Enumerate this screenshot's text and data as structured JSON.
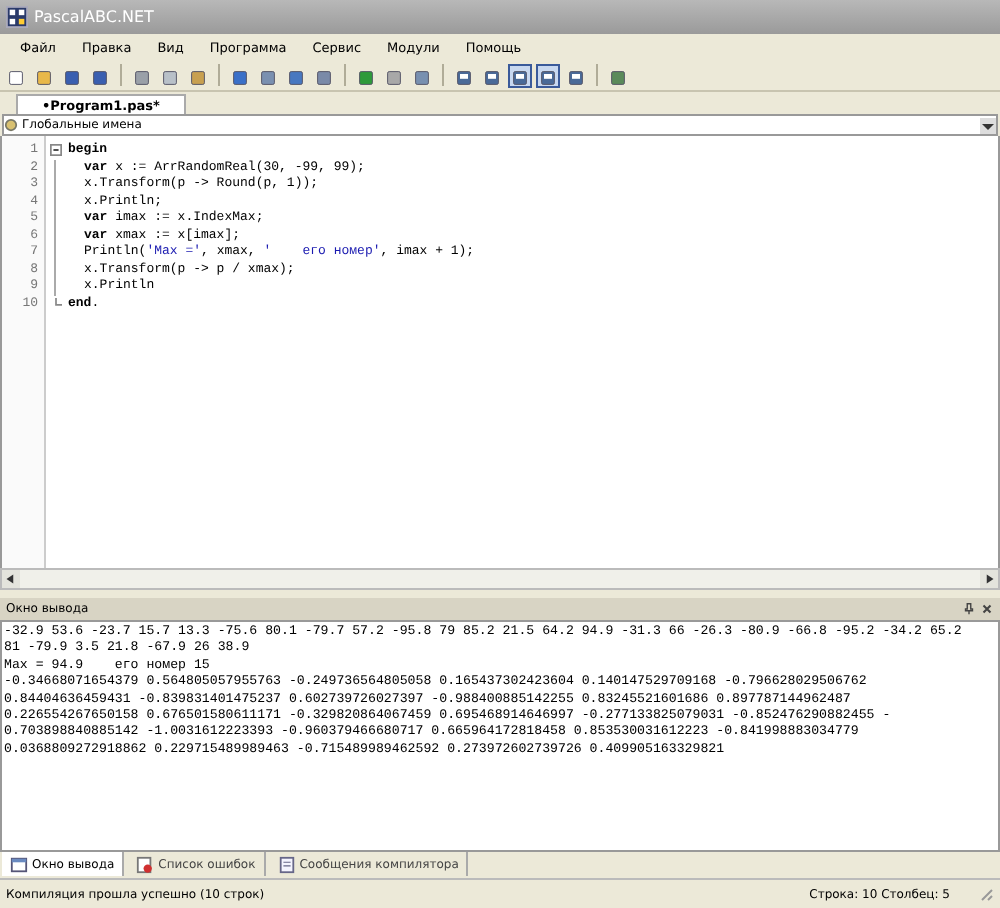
{
  "window": {
    "title": "PascalABC.NET"
  },
  "menu": [
    "Файл",
    "Правка",
    "Вид",
    "Программа",
    "Сервис",
    "Модули",
    "Помощь"
  ],
  "toolbar": [
    [
      {
        "kind": "new",
        "pressed": false
      },
      {
        "kind": "open",
        "pressed": false
      },
      {
        "kind": "save",
        "pressed": false
      },
      {
        "kind": "saveall",
        "pressed": false
      }
    ],
    [
      {
        "kind": "cut",
        "pressed": false
      },
      {
        "kind": "copy",
        "pressed": false
      },
      {
        "kind": "paste",
        "pressed": false
      }
    ],
    [
      {
        "kind": "undo",
        "pressed": false
      },
      {
        "kind": "redo",
        "pressed": false
      },
      {
        "kind": "build",
        "pressed": false
      },
      {
        "kind": "rebuild",
        "pressed": false
      }
    ],
    [
      {
        "kind": "run",
        "pressed": false
      },
      {
        "kind": "stop",
        "pressed": false
      },
      {
        "kind": "window",
        "pressed": false
      }
    ],
    [
      {
        "kind": "panel",
        "pressed": false
      },
      {
        "kind": "panel",
        "pressed": false
      },
      {
        "kind": "panel",
        "pressed": true
      },
      {
        "kind": "panel",
        "pressed": true
      },
      {
        "kind": "panel",
        "pressed": false
      }
    ],
    [
      {
        "kind": "grid",
        "pressed": false
      }
    ]
  ],
  "tabs": [
    {
      "label": "•Program1.pas*",
      "selected": true
    }
  ],
  "scope": {
    "value": "Глобальные имена"
  },
  "editor": {
    "lines": [
      {
        "number": "1",
        "expanded": true,
        "tokens": [
          {
            "t": "begin",
            "kind": "keyword"
          }
        ],
        "children": [
          {
            "number": "2",
            "tokens": [
              {
                "t": "var",
                "kind": "keyword"
              },
              {
                "t": " x := ArrRandomReal(30, -99, 99);",
                "kind": "plain"
              }
            ]
          },
          {
            "number": "3",
            "tokens": [
              {
                "t": "x.Transform(p -> Round(p, 1));",
                "kind": "plain"
              }
            ]
          },
          {
            "number": "4",
            "tokens": [
              {
                "t": "x.Println;",
                "kind": "plain"
              }
            ]
          },
          {
            "number": "5",
            "tokens": [
              {
                "t": "var",
                "kind": "keyword"
              },
              {
                "t": " imax := x.IndexMax;",
                "kind": "plain"
              }
            ]
          },
          {
            "number": "6",
            "tokens": [
              {
                "t": "var",
                "kind": "keyword"
              },
              {
                "t": " xmax := x[imax];",
                "kind": "plain"
              }
            ]
          },
          {
            "number": "7",
            "tokens": [
              {
                "t": "Println(",
                "kind": "plain"
              },
              {
                "t": "'Max ='",
                "kind": "string"
              },
              {
                "t": ", xmax, ",
                "kind": "plain"
              },
              {
                "t": "'    его номер'",
                "kind": "string"
              },
              {
                "t": ", imax + 1);",
                "kind": "plain"
              }
            ]
          },
          {
            "number": "8",
            "tokens": [
              {
                "t": "x.Transform(p -> p / xmax);",
                "kind": "plain"
              }
            ]
          },
          {
            "number": "9",
            "tokens": [
              {
                "t": "x.Println",
                "kind": "plain"
              }
            ]
          }
        ]
      },
      {
        "number": "10",
        "tokens": [
          {
            "t": "end",
            "kind": "keyword"
          },
          {
            "t": ".",
            "kind": "plain"
          }
        ]
      }
    ]
  },
  "output": {
    "title": "Окно вывода",
    "lines": [
      "-32.9 53.6 -23.7 15.7 13.3 -75.6 80.1 -79.7 57.2 -95.8 79 85.2 21.5 64.2 94.9 -31.3 66 -26.3 -80.9 -66.8 -95.2 -34.2 65.2",
      "81 -79.9 3.5 21.8 -67.9 26 38.9",
      "Max = 94.9    его номер 15",
      "-0.34668071654379 0.564805057955763 -0.249736564805058 0.165437302423604 0.140147529709168 -0.796628029506762",
      "0.84404636459431 -0.839831401475237 0.602739726027397 -0.988400885142255 0.83245521601686 0.897787144962487",
      "0.226554267650158 0.676501580611171 -0.329820864067459 0.695468914646997 -0.277133825079031 -0.852476290882455 -",
      "0.703898840885142 -1.0031612223393 -0.960379466680717 0.665964172818458 0.853530031612223 -0.841998883034779",
      "0.0368809272918862 0.229715489989463 -0.715489989462592 0.273972602739726 0.409905163329821"
    ]
  },
  "bottom_tabs": [
    {
      "label": "Окно вывода",
      "kind": "output",
      "selected": true
    },
    {
      "label": "Список ошибок",
      "kind": "errors",
      "selected": false
    },
    {
      "label": "Сообщения компилятора",
      "kind": "messages",
      "selected": false
    }
  ],
  "status_bar": {
    "message": "Компиляция прошла успешно (10 строк)",
    "position": "Строка: 10  Столбец: 5"
  }
}
